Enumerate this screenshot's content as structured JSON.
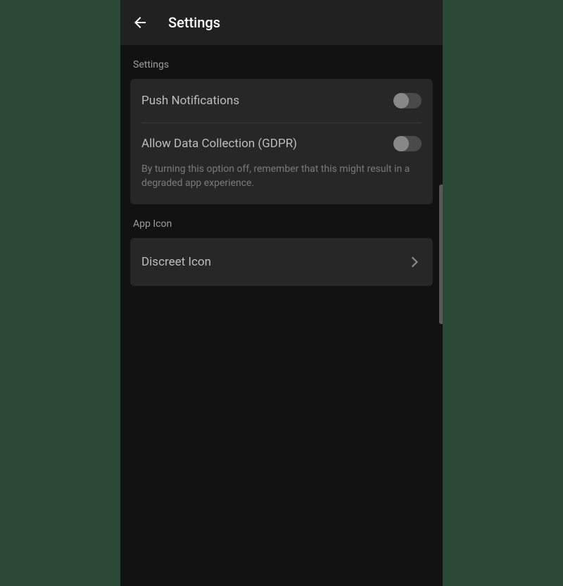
{
  "header": {
    "title": "Settings"
  },
  "sections": {
    "settings": {
      "label": "Settings",
      "items": {
        "push": {
          "label": "Push Notifications",
          "enabled": false
        },
        "gdpr": {
          "label": "Allow Data Collection (GDPR)",
          "enabled": false,
          "description": "By turning this option off, remember that this might result in a degraded app experience."
        }
      }
    },
    "appIcon": {
      "label": "App Icon",
      "items": {
        "discreet": {
          "label": "Discreet Icon"
        }
      }
    }
  }
}
